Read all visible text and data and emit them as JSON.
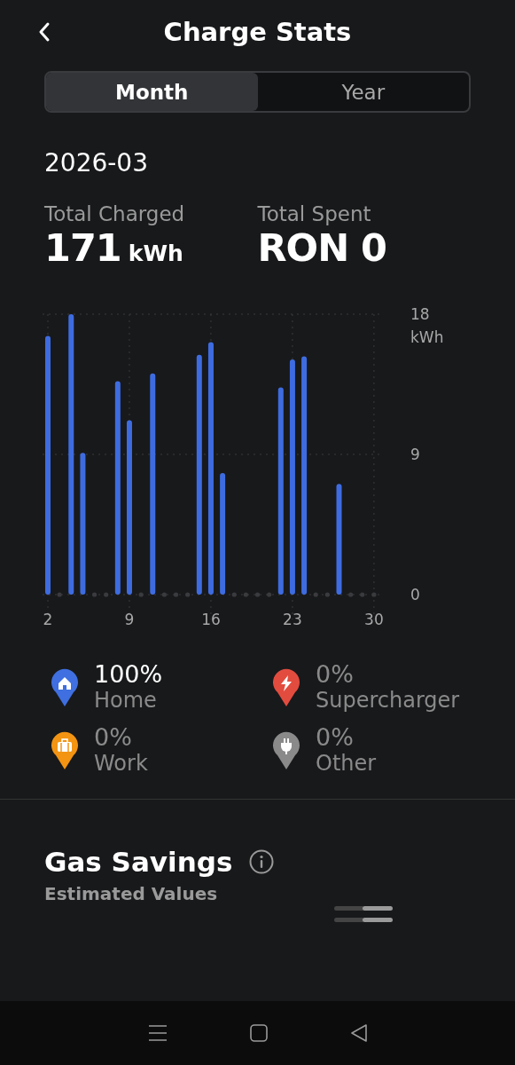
{
  "header": {
    "title": "Charge Stats"
  },
  "tabs": [
    {
      "label": "Month",
      "selected": true
    },
    {
      "label": "Year",
      "selected": false
    }
  ],
  "period": "2026-03",
  "stats": [
    {
      "label": "Total Charged",
      "value": "171",
      "unit": "kWh"
    },
    {
      "label": "Total Spent",
      "value": "RON 0"
    }
  ],
  "chart": {
    "chart_data": {
      "type": "bar",
      "x": [
        2,
        4,
        5,
        8,
        9,
        11,
        15,
        16,
        17,
        22,
        23,
        24,
        27
      ],
      "values": [
        16.6,
        18.0,
        9.1,
        13.7,
        11.2,
        14.2,
        15.4,
        16.2,
        7.8,
        13.3,
        15.1,
        15.3,
        7.1
      ],
      "xlim": [
        2,
        30
      ],
      "ylim": [
        0,
        18
      ],
      "yticks": [
        0,
        9,
        18
      ],
      "ylabel": "kWh",
      "xticks": [
        2,
        9,
        16,
        23,
        30
      ],
      "grid": true
    }
  },
  "legend": [
    {
      "kind": "home",
      "percent": "100%",
      "label": "Home",
      "color": "#3f6fe0",
      "active": true
    },
    {
      "kind": "supercharger",
      "percent": "0%",
      "label": "Supercharger",
      "color": "#e24c3f",
      "active": false
    },
    {
      "kind": "work",
      "percent": "0%",
      "label": "Work",
      "color": "#f39412",
      "active": false
    },
    {
      "kind": "other",
      "percent": "0%",
      "label": "Other",
      "color": "#8a8a8a",
      "active": false
    }
  ],
  "gas_savings": {
    "title": "Gas Savings",
    "subtitle": "Estimated Values"
  }
}
